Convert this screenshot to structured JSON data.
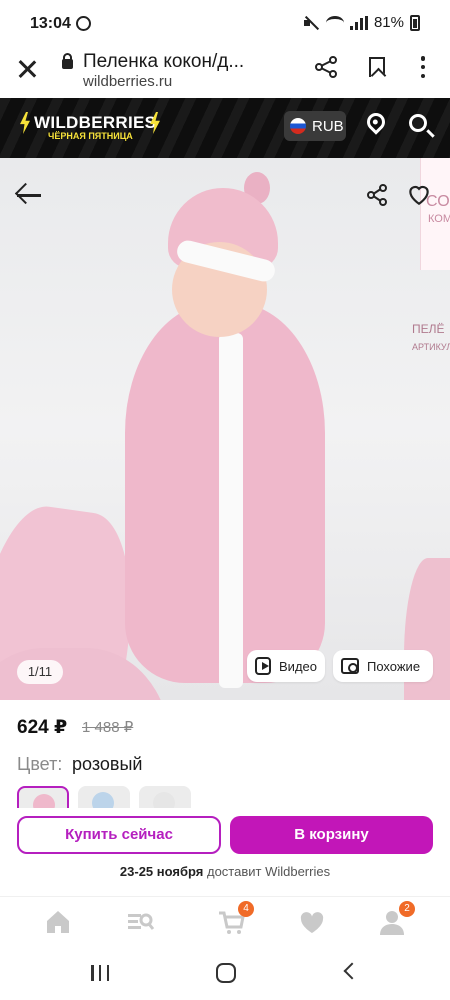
{
  "status_bar": {
    "time": "13:04",
    "battery": "81%"
  },
  "browser": {
    "title": "Пеленка кокон/д...",
    "domain": "wildberries.ru"
  },
  "header": {
    "logo": "WILDBERRIES",
    "subtitle": "ЧЁРНАЯ ПЯТНИЦА",
    "currency": "RUB"
  },
  "gallery": {
    "counter": "1/11",
    "video_label": "Видео",
    "similar_label": "Похожие",
    "panel_text": "СО",
    "panel_text2": "КОМ",
    "label_text": "ПЕЛЁ",
    "label_text2": "АРТИКУЛ"
  },
  "product": {
    "price": "624 ₽",
    "old_price": "1 488 ₽",
    "color_label": "Цвет:",
    "color_value": "розовый",
    "swatches": [
      {
        "color": "#efb8cb",
        "selected": true
      },
      {
        "color": "#bcd4ea",
        "selected": false
      },
      {
        "color": "#e6e6e6",
        "selected": false
      }
    ]
  },
  "actions": {
    "buy_now": "Купить сейчас",
    "add_to_cart": "В корзину",
    "delivery_date": "23-25 ноября",
    "delivery_text": "доставит Wildberries"
  },
  "tab_bar": {
    "cart_badge": "4",
    "profile_badge": "2"
  },
  "colors": {
    "brand": "#c216b8",
    "brand_outline": "#b51fbf",
    "badge": "#f06b28"
  }
}
